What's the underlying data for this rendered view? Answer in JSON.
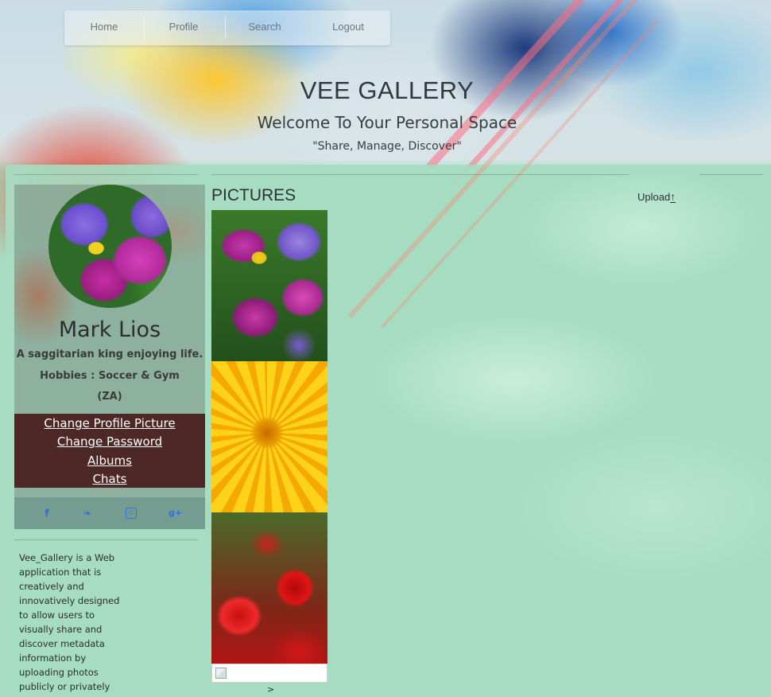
{
  "app": {
    "title": "VEE GALLERY",
    "subtitle": "Welcome To Your Personal Space",
    "tagline": "\"Share, Manage, Discover\""
  },
  "nav": {
    "items": [
      {
        "label": "Home"
      },
      {
        "label": "Profile"
      },
      {
        "label": "Search"
      },
      {
        "label": "Logout"
      }
    ]
  },
  "profile": {
    "name": "Mark Lios",
    "bio": "A saggitarian king enjoying life.",
    "hobbies": "Hobbies : Soccer & Gym",
    "country": "(ZA)",
    "menu": [
      {
        "label": "Change Profile Picture"
      },
      {
        "label": "Change Password"
      },
      {
        "label": "Albums"
      },
      {
        "label": "Chats"
      }
    ],
    "socials": [
      {
        "icon": "facebook-icon",
        "glyph": "f"
      },
      {
        "icon": "twitter-icon",
        "glyph": "❧"
      },
      {
        "icon": "instagram-icon",
        "glyph": "○"
      },
      {
        "icon": "google-plus-icon",
        "glyph": "g+"
      }
    ]
  },
  "about": "Vee_Gallery is a Web application that is creatively and innovatively designed to allow users to visually share and discover metadata information by uploading photos publicly or privately",
  "pictures": {
    "title": "PICTURES",
    "upload_label": "Upload",
    "upload_icon": "↑",
    "pager": ">"
  },
  "colors": {
    "menu_bg": "#4d2826",
    "panel_bg": "#a6dcc2",
    "social_icon": "#2f6fe0"
  }
}
